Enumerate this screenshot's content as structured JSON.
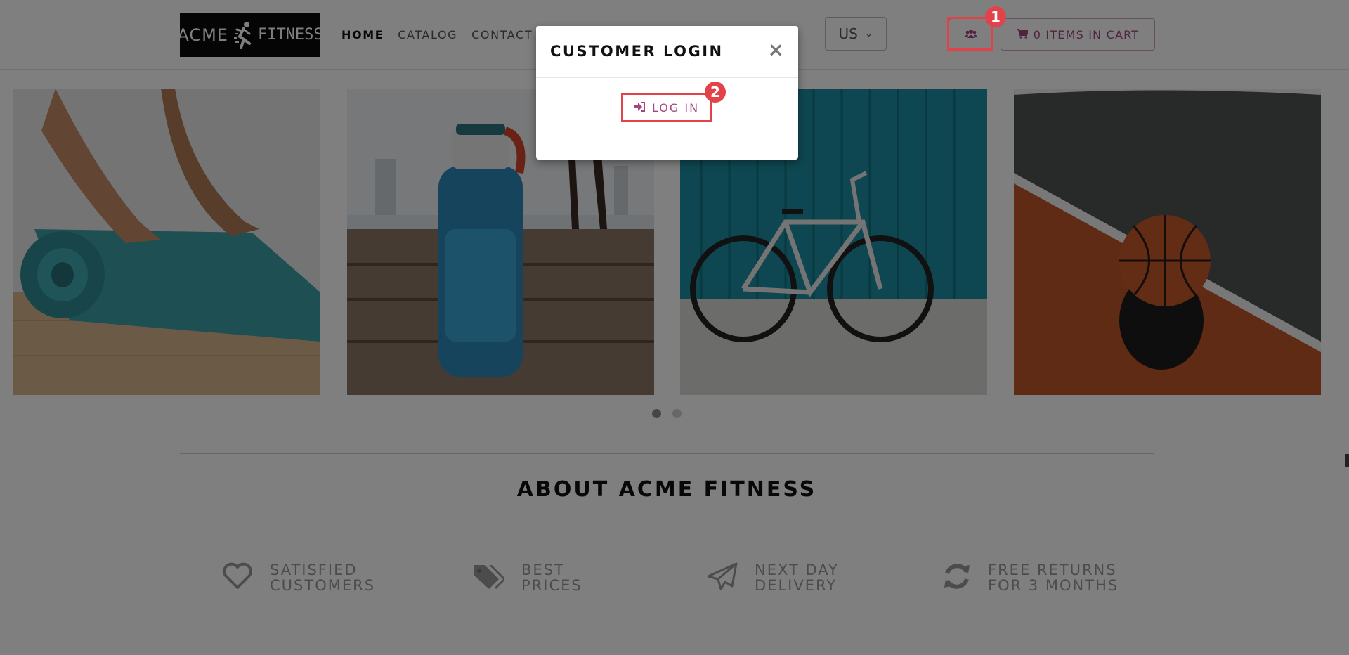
{
  "header": {
    "logo": {
      "left": "ACME",
      "right": "FITNESS"
    },
    "nav": [
      {
        "label": "HOME",
        "active": true
      },
      {
        "label": "CATALOG",
        "active": false
      },
      {
        "label": "CONTACT",
        "active": false
      }
    ],
    "region": {
      "selected": "US"
    },
    "user_icon": "users-icon",
    "cart": {
      "label": "0 ITEMS IN CART",
      "icon": "shopping-cart-icon"
    }
  },
  "carousel": {
    "slides": [
      {
        "name": "yoga-mat"
      },
      {
        "name": "water-bottle"
      },
      {
        "name": "bicycle"
      },
      {
        "name": "basketball"
      }
    ],
    "page_count": 2,
    "active_page": 1
  },
  "about": {
    "title": "ABOUT ACME FITNESS",
    "features": [
      {
        "icon": "heart-icon",
        "line1": "SATISFIED",
        "line2": "CUSTOMERS"
      },
      {
        "icon": "tags-icon",
        "line1": "BEST",
        "line2": "PRICES"
      },
      {
        "icon": "paper-plane-icon",
        "line1": "NEXT DAY",
        "line2": "DELIVERY"
      },
      {
        "icon": "refresh-icon",
        "line1": "FREE RETURNS",
        "line2": "FOR 3 MONTHS"
      }
    ]
  },
  "modal": {
    "title": "CUSTOMER LOGIN",
    "close": "×",
    "login_label": "LOG IN",
    "login_icon": "sign-in-icon"
  },
  "annotations": {
    "marker1": "1",
    "marker2": "2",
    "color": "#e2434b"
  },
  "colors": {
    "accent": "#a4457f",
    "overlay": "rgba(0,0,0,0.5)"
  }
}
